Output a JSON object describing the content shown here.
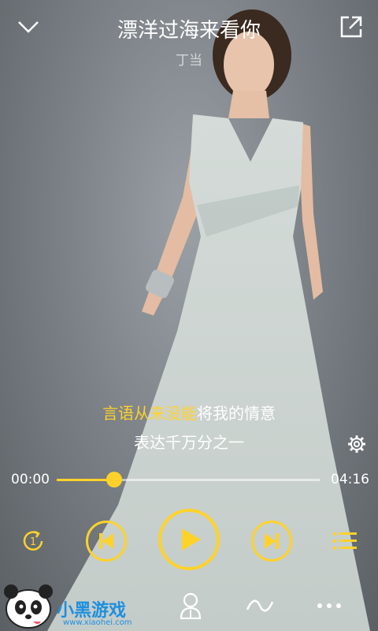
{
  "header": {
    "title": "漂洋过海来看你",
    "artist": "丁当"
  },
  "lyrics": {
    "line1_highlight": "言语从来没能",
    "line1_rest": "将我的情意",
    "line2": "表达千万分之一"
  },
  "progress": {
    "elapsed": "00:00",
    "duration": "04:16",
    "fraction": 0.22
  },
  "colors": {
    "accent": "#ffd22a",
    "text": "#ffffff"
  },
  "icons": {
    "collapse": "chevron-down-icon",
    "share": "share-icon",
    "settings": "gear-icon",
    "repeat": "repeat-one-icon",
    "previous": "previous-icon",
    "play": "play-icon",
    "next": "next-icon",
    "playlist": "playlist-icon",
    "singer": "singer-icon",
    "wave": "wave-icon",
    "more": "more-icon"
  },
  "watermark": {
    "brand": "小黑游戏",
    "url": "www.xiaohei.com"
  }
}
